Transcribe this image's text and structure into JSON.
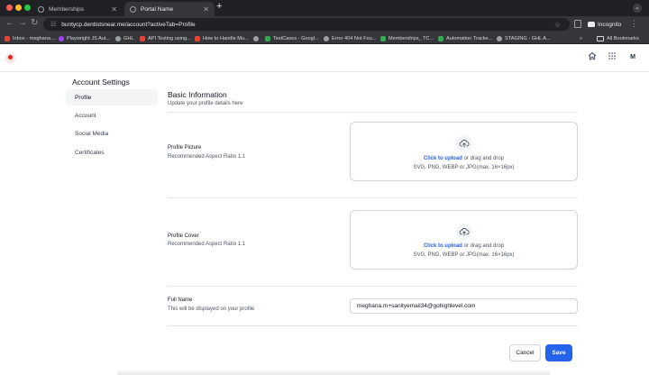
{
  "browser": {
    "tabs": [
      {
        "label": "Memberships",
        "active": false
      },
      {
        "label": "Portal Name",
        "active": true
      }
    ],
    "new_tab": "+",
    "tab_menu": "⌄",
    "url": "buntycp.dentistsnear.me/account?activeTab=Profile",
    "incognito_label": "Incognito",
    "bookmarks": [
      {
        "label": "Inbox - meghana....",
        "color": "#ea4335"
      },
      {
        "label": "Playwright JS Aut...",
        "color": "#a142f4"
      },
      {
        "label": "GHL",
        "color": "#9aa0a6"
      },
      {
        "label": "API Testing using...",
        "color": "#ea4335"
      },
      {
        "label": "How to Handle Mu...",
        "color": "#ea4335"
      },
      {
        "label": "",
        "color": "#9aa0a6"
      },
      {
        "label": "TestCases - Googl...",
        "color": "#34a853"
      },
      {
        "label": "Error 404 Not Fou...",
        "color": "#9aa0a6"
      },
      {
        "label": "Memberships_ TC...",
        "color": "#34a853"
      },
      {
        "label": "Automation Tracke...",
        "color": "#34a853"
      },
      {
        "label": "STAGING - GHL A...",
        "color": "#9aa0a6"
      }
    ],
    "more_bookmarks": "»",
    "all_bookmarks": "All Bookmarks"
  },
  "header": {
    "avatar_initial": "M"
  },
  "sidebar": {
    "title": "Account Settings",
    "items": [
      {
        "label": "Profile",
        "active": true
      },
      {
        "label": "Account",
        "active": false
      },
      {
        "label": "Social Media",
        "active": false
      },
      {
        "label": "Certificates",
        "active": false
      }
    ]
  },
  "main": {
    "title": "Basic Information",
    "subtitle": "Update your profile details here",
    "profile_picture": {
      "label": "Profile Picture",
      "hint": "Recommended Aspect Ratio 1:1",
      "upload_link": "Click to upload",
      "upload_text": " or drag and drop",
      "formats": "SVG, PNG, WEBP or JPG(max. 16×16px)"
    },
    "profile_cover": {
      "label": "Profile Cover",
      "hint": "Recommended Aspect Ratio 1:1",
      "upload_link": "Click to upload",
      "upload_text": " or drag and drop",
      "formats": "SVG, PNG, WEBP or JPG(max. 16×16px)"
    },
    "full_name": {
      "label": "Full Name",
      "hint": "This will be displayed on your profile",
      "value": "meghana.m+sanityemail34@gohighlevel.com"
    },
    "cancel_label": "Cancel",
    "save_label": "Save"
  },
  "colors": {
    "primary": "#2563eb",
    "active_nav": "#f3f4f6",
    "border": "#d1d5db"
  }
}
